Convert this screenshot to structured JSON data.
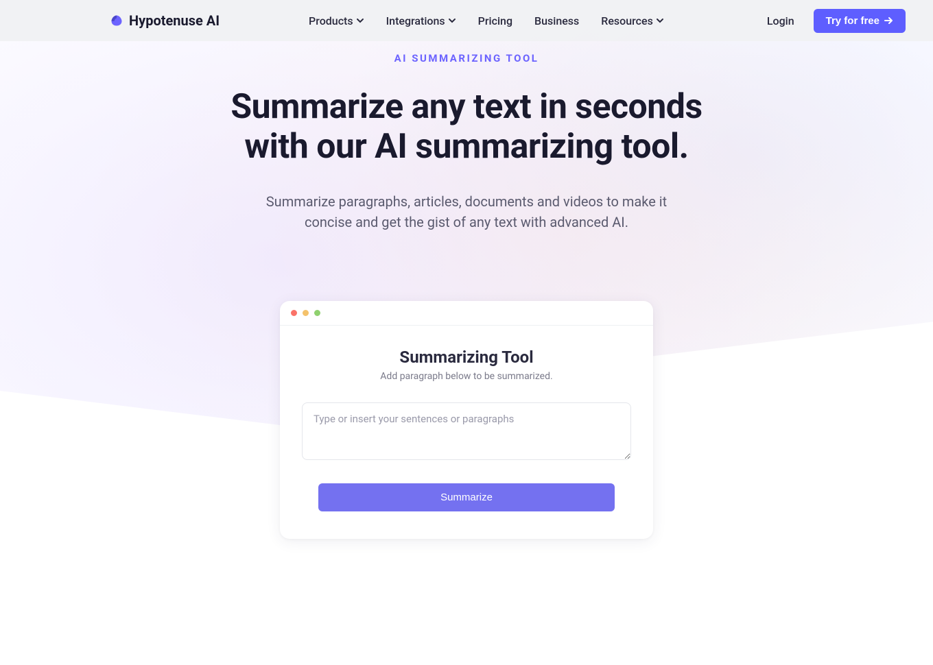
{
  "brand": {
    "name": "Hypotenuse AI"
  },
  "nav": {
    "items": [
      {
        "label": "Products",
        "hasDropdown": true
      },
      {
        "label": "Integrations",
        "hasDropdown": true
      },
      {
        "label": "Pricing",
        "hasDropdown": false
      },
      {
        "label": "Business",
        "hasDropdown": false
      },
      {
        "label": "Resources",
        "hasDropdown": true
      }
    ],
    "login": "Login",
    "cta": "Try for free"
  },
  "hero": {
    "eyebrow": "AI SUMMARIZING TOOL",
    "headline_line1": "Summarize any text in seconds",
    "headline_line2": "with our AI summarizing tool.",
    "sub_line1": "Summarize paragraphs, articles, documents and videos to make it",
    "sub_line2": "concise and get the gist of any text with advanced AI."
  },
  "tool": {
    "title": "Summarizing Tool",
    "subtitle": "Add paragraph below to be summarized.",
    "placeholder": "Type or insert your sentences or paragraphs",
    "button": "Summarize"
  }
}
